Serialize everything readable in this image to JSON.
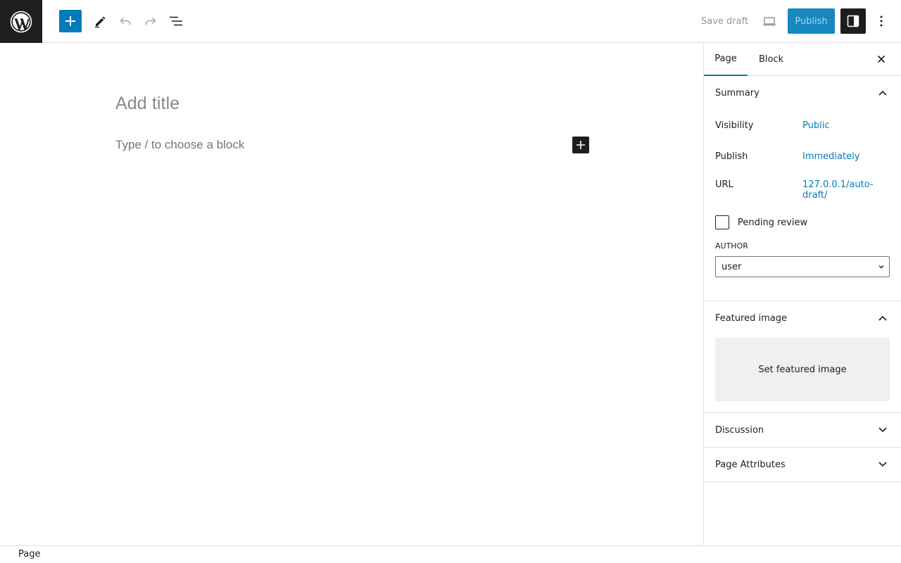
{
  "toolbar": {
    "logo_icon": "wordpress-logo",
    "inserter_icon": "plus-icon",
    "tools_icon": "pencil-icon",
    "undo_icon": "undo-icon",
    "redo_icon": "redo-icon",
    "document_overview_icon": "list-view-icon",
    "save_draft_label": "Save draft",
    "preview_icon": "desktop-icon",
    "publish_label": "Publish",
    "settings_icon": "sidebar-icon",
    "options_icon": "more-vertical-icon"
  },
  "editor": {
    "title_placeholder": "Add title",
    "block_placeholder": "Type / to choose a block"
  },
  "sidebar": {
    "tabs": [
      {
        "label": "Page",
        "active": true
      },
      {
        "label": "Block",
        "active": false
      }
    ],
    "summary": {
      "heading": "Summary",
      "expanded": true,
      "visibility_label": "Visibility",
      "visibility_value": "Public",
      "publish_label": "Publish",
      "publish_value": "Immediately",
      "url_label": "URL",
      "url_value": "127.0.0.1/auto-draft/",
      "pending_review_label": "Pending review",
      "pending_review_checked": false,
      "author_label": "Author",
      "author_value": "user"
    },
    "featured_image": {
      "heading": "Featured image",
      "expanded": true,
      "button_label": "Set featured image"
    },
    "discussion": {
      "heading": "Discussion",
      "expanded": false
    },
    "page_attributes": {
      "heading": "Page Attributes",
      "expanded": false
    }
  },
  "footer": {
    "breadcrumb": "Page"
  },
  "colors": {
    "accent": "#007cba",
    "dark": "#1e1e1e",
    "border": "#e0e0e0",
    "muted": "#757575"
  }
}
